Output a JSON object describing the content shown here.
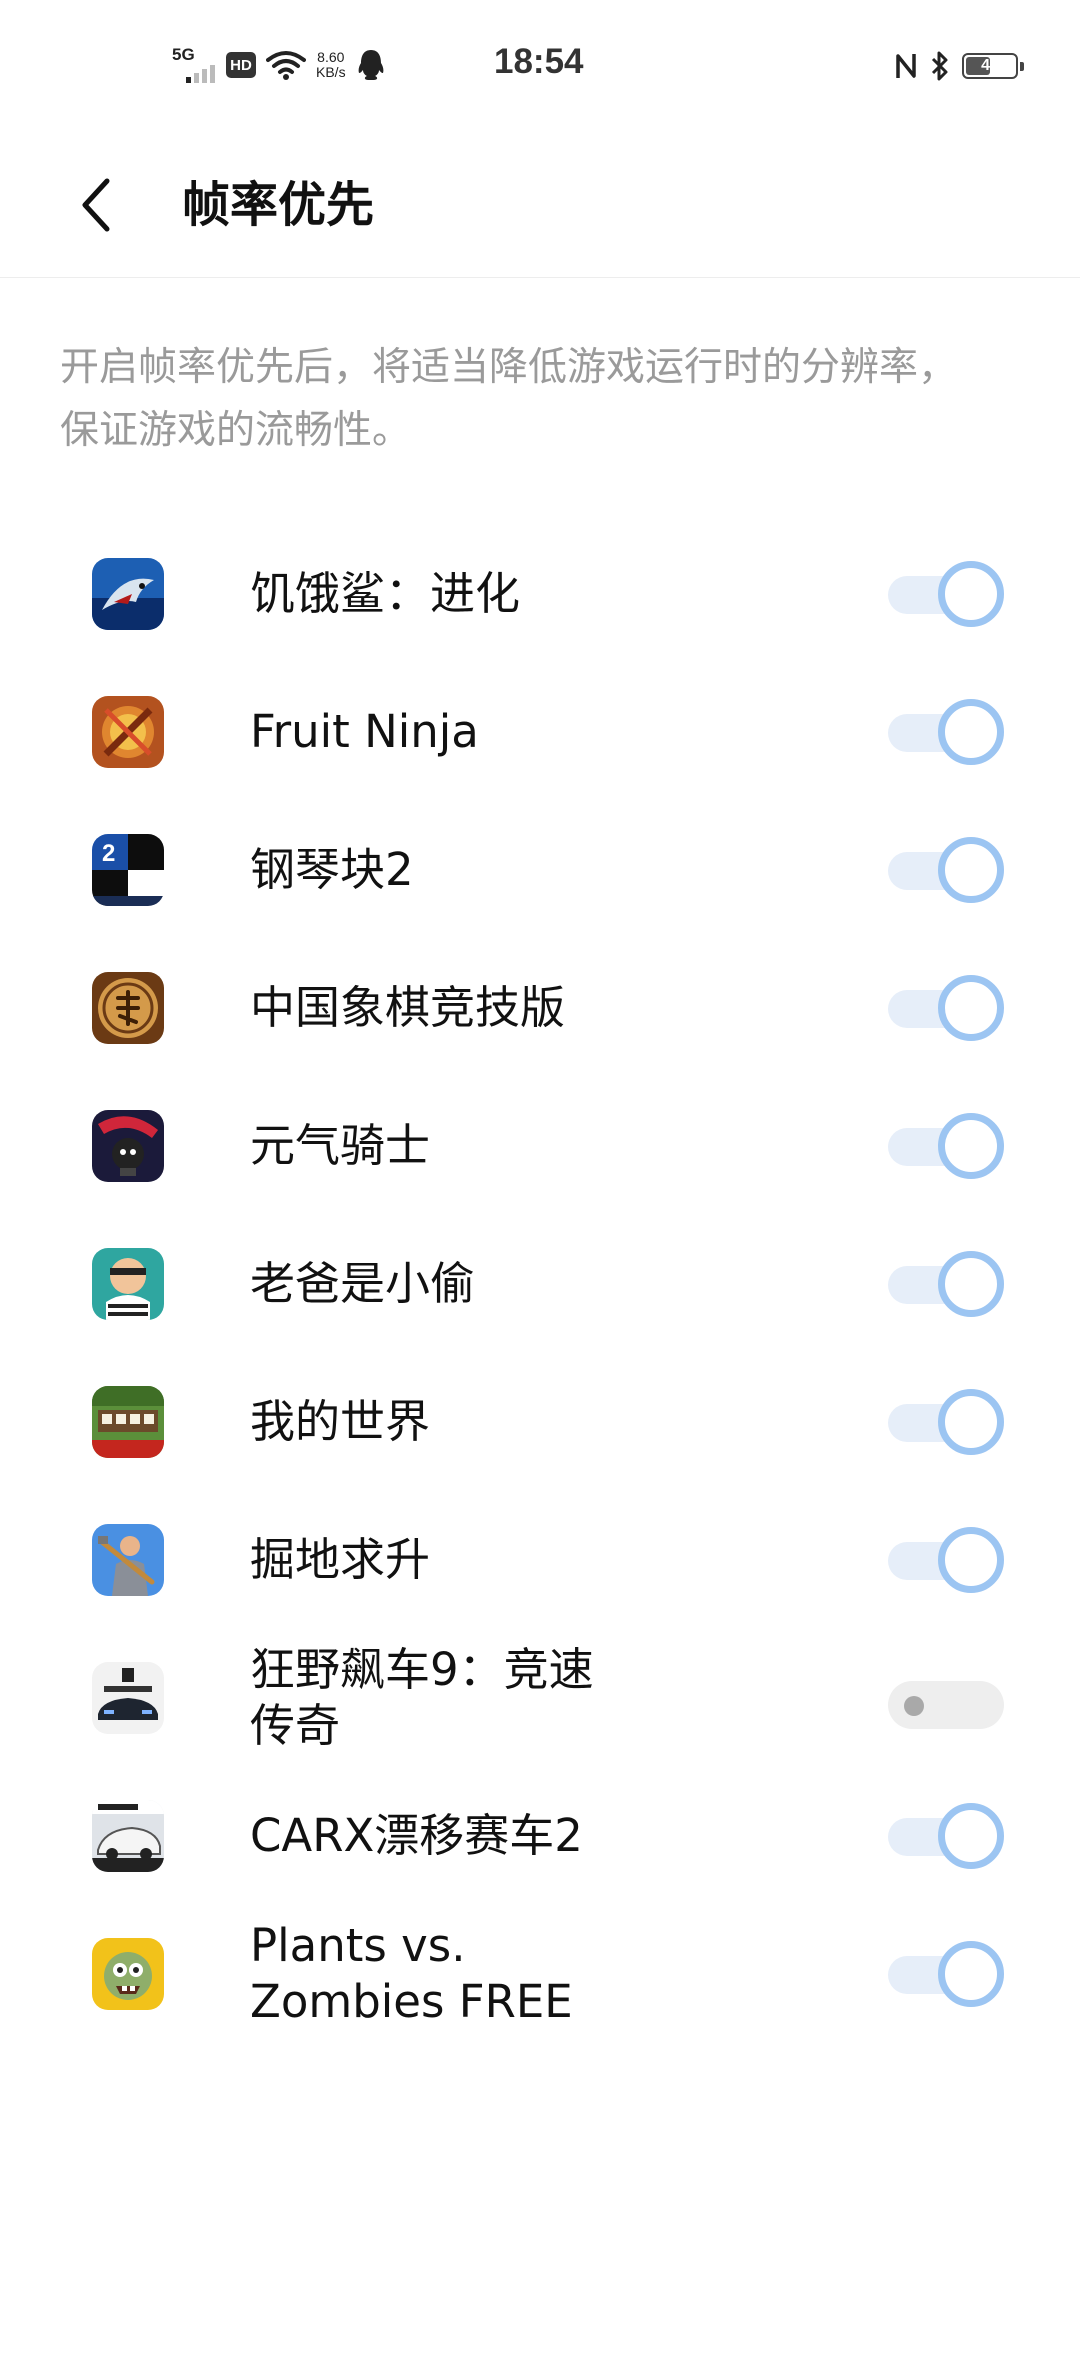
{
  "status_bar": {
    "network": "5G",
    "hd": "HD",
    "speed_value": "8.60",
    "speed_unit": "KB/s",
    "time": "18:54",
    "battery": "46"
  },
  "header": {
    "title": "帧率优先"
  },
  "description": "开启帧率优先后，将适当降低游戏运行时的分辨率，保证游戏的流畅性。",
  "games": [
    {
      "name": "饥饿鲨：进化",
      "enabled": true,
      "icon": "hungry-shark-icon"
    },
    {
      "name": "Fruit Ninja",
      "enabled": true,
      "icon": "fruit-ninja-icon"
    },
    {
      "name": "钢琴块2",
      "enabled": true,
      "icon": "piano-tiles-icon"
    },
    {
      "name": "中国象棋竞技版",
      "enabled": true,
      "icon": "chinese-chess-icon"
    },
    {
      "name": "元气骑士",
      "enabled": true,
      "icon": "soul-knight-icon"
    },
    {
      "name": "老爸是小偷",
      "enabled": true,
      "icon": "robbery-bob-icon"
    },
    {
      "name": "我的世界",
      "enabled": true,
      "icon": "minecraft-icon"
    },
    {
      "name": "掘地求升",
      "enabled": true,
      "icon": "getting-over-it-icon"
    },
    {
      "name": "狂野飙车9：竞速传奇",
      "enabled": false,
      "icon": "asphalt-9-icon"
    },
    {
      "name": "CARX漂移赛车2",
      "enabled": true,
      "icon": "carx-drift-icon"
    },
    {
      "name": "Plants vs. Zombies FREE",
      "enabled": true,
      "icon": "plants-vs-zombies-icon"
    }
  ],
  "colors": {
    "toggle_on_track": "#e6eef9",
    "toggle_on_ring": "#9cc5f2",
    "toggle_off_track": "#eeeeee",
    "toggle_off_dot": "#a9a9a9",
    "description_text": "#9a9a9a"
  }
}
